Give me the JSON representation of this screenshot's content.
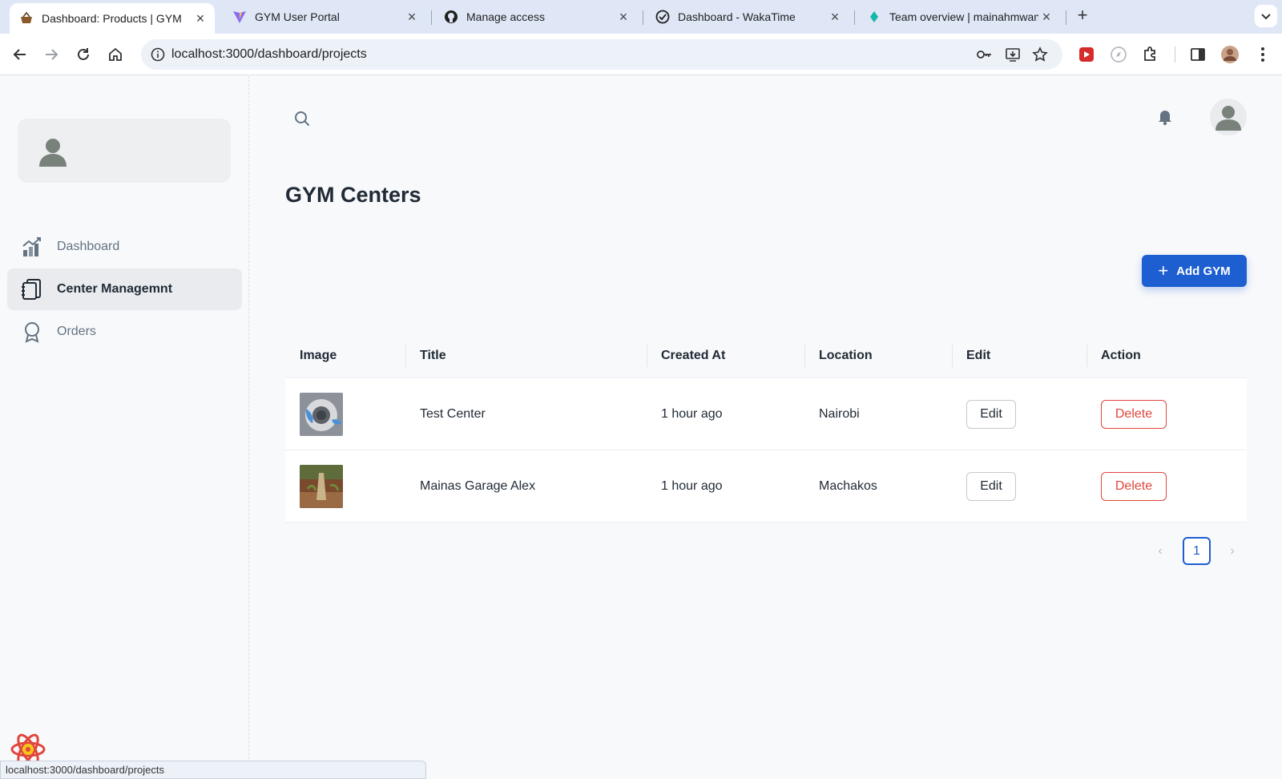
{
  "browser": {
    "tabs": [
      {
        "title": "Dashboard: Products | GYM",
        "icon": "basket-favicon",
        "active": true
      },
      {
        "title": "GYM User Portal",
        "icon": "vite-favicon",
        "active": false
      },
      {
        "title": "Manage access",
        "icon": "github-favicon",
        "active": false
      },
      {
        "title": "Dashboard - WakaTime",
        "icon": "wakatime-favicon",
        "active": false
      },
      {
        "title": "Team overview | mainahmwan",
        "icon": "diamond-favicon",
        "active": false
      }
    ],
    "url": "localhost:3000/dashboard/projects",
    "status_url": "localhost:3000/dashboard/projects"
  },
  "sidebar": {
    "items": [
      {
        "label": "Dashboard",
        "icon": "chart-icon",
        "active": false
      },
      {
        "label": "Center Managemnt",
        "icon": "documents-icon",
        "active": true
      },
      {
        "label": "Orders",
        "icon": "badge-icon",
        "active": false
      }
    ]
  },
  "page": {
    "title": "GYM Centers",
    "add_button": "Add GYM"
  },
  "table": {
    "columns": [
      "Image",
      "Title",
      "Created At",
      "Location",
      "Edit",
      "Action"
    ],
    "rows": [
      {
        "title": "Test Center",
        "created_at": "1 hour ago",
        "location": "Nairobi",
        "edit": "Edit",
        "action": "Delete"
      },
      {
        "title": "Mainas Garage Alex",
        "created_at": "1 hour ago",
        "location": "Machakos",
        "edit": "Edit",
        "action": "Delete"
      }
    ]
  },
  "pagination": {
    "current": "1",
    "prev": "‹",
    "next": "›"
  },
  "colors": {
    "primary": "#1d5fd0",
    "danger": "#e0463c",
    "text": "#212b36",
    "muted": "#637381"
  }
}
